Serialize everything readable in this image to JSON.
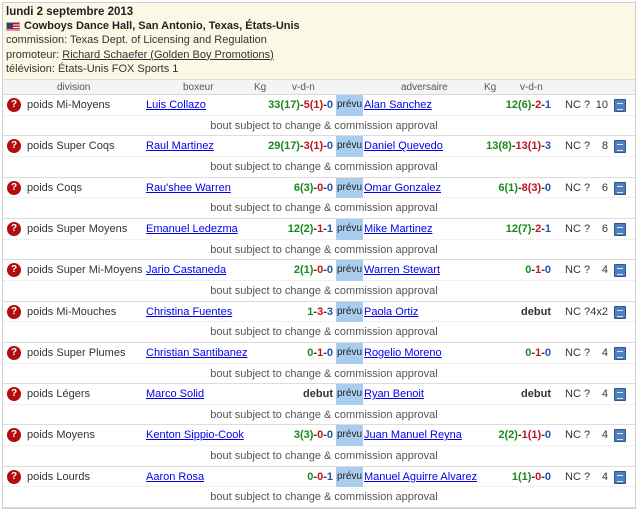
{
  "event": {
    "date": "lundi 2 septembre 2013",
    "venue": "Cowboys Dance Hall, San Antonio, Texas, États-Unis",
    "commission_label": "commission: Texas Dept. of Licensing and Regulation",
    "promoter_prefix": "promoteur: ",
    "promoter_name": "Richard Schaefer (Golden Boy Promotions)",
    "tv_label": "télévision: États-Unis FOX Sports 1"
  },
  "columns": {
    "division": "division",
    "boxer": "boxeur",
    "kg1": "Kg",
    "vdn1": "v-d-n",
    "opponent": "adversaire",
    "kg2": "Kg",
    "vdn2": "v-d-n"
  },
  "labels": {
    "status": "prévu",
    "note": "bout subject to change & commission approval",
    "q_icon": "?"
  },
  "colors": {
    "won": "#1a8a1a",
    "lost": "#c0141e",
    "draw": "#2850b8",
    "prevu_bg": "#a9cdee",
    "header_bg": "#fbf8e6"
  },
  "bouts": [
    {
      "division": "poids Mi-Moyens",
      "boxer": "Luis Collazo",
      "rec1": {
        "w": "33(17)",
        "d": "5(1)",
        "n": "0"
      },
      "opponent": "Alan Sanchez",
      "rec2": {
        "w": "12(6)",
        "d": "2",
        "n": "1"
      },
      "nc": "NC ?",
      "rounds": "10"
    },
    {
      "division": "poids Super Coqs",
      "boxer": "Raul Martinez",
      "rec1": {
        "w": "29(17)",
        "d": "3(1)",
        "n": "0"
      },
      "opponent": "Daniel Quevedo",
      "rec2": {
        "w": "13(8)",
        "d": "13(1)",
        "n": "3"
      },
      "nc": "NC ?",
      "rounds": "8"
    },
    {
      "division": "poids Coqs",
      "boxer": "Rau'shee Warren",
      "rec1": {
        "w": "6(3)",
        "d": "0",
        "n": "0"
      },
      "opponent": "Omar Gonzalez",
      "rec2": {
        "w": "6(1)",
        "d": "8(3)",
        "n": "0"
      },
      "nc": "NC ?",
      "rounds": "6"
    },
    {
      "division": "poids Super Moyens",
      "boxer": "Emanuel Ledezma",
      "rec1": {
        "w": "12(2)",
        "d": "1",
        "n": "1"
      },
      "opponent": "Mike Martinez",
      "rec2": {
        "w": "12(7)",
        "d": "2",
        "n": "1"
      },
      "nc": "NC ?",
      "rounds": "6"
    },
    {
      "division": "poids Super Mi-Moyens",
      "boxer": "Jario Castaneda",
      "rec1": {
        "w": "2(1)",
        "d": "0",
        "n": "0"
      },
      "opponent": "Warren Stewart",
      "rec2": {
        "w": "0",
        "d": "1",
        "n": "0"
      },
      "nc": "NC ?",
      "rounds": "4"
    },
    {
      "division": "poids Mi-Mouches",
      "boxer": "Christina Fuentes",
      "rec1": {
        "w": "1",
        "d": "3",
        "n": "3"
      },
      "opponent": "Paola Ortiz",
      "rec2_debut": "debut",
      "nc": "NC ?",
      "rounds": "4x2"
    },
    {
      "division": "poids Super Plumes",
      "boxer": "Christian Santibanez",
      "rec1": {
        "w": "0",
        "d": "1",
        "n": "0"
      },
      "opponent": "Rogelio Moreno",
      "rec2": {
        "w": "0",
        "d": "1",
        "n": "0"
      },
      "nc": "NC ?",
      "rounds": "4"
    },
    {
      "division": "poids Légers",
      "boxer": "Marco Solid",
      "rec1_debut": "debut",
      "opponent": "Ryan Benoit",
      "rec2_debut": "debut",
      "nc": "NC ?",
      "rounds": "4"
    },
    {
      "division": "poids Moyens",
      "boxer": "Kenton Sippio-Cook",
      "rec1": {
        "w": "3(3)",
        "d": "0",
        "n": "0"
      },
      "opponent": "Juan Manuel Reyna",
      "rec2": {
        "w": "2(2)",
        "d": "1(1)",
        "n": "0"
      },
      "nc": "NC ?",
      "rounds": "4"
    },
    {
      "division": "poids Lourds",
      "boxer": "Aaron Rosa",
      "rec1": {
        "w": "0",
        "d": "0",
        "n": "1"
      },
      "opponent": "Manuel Aguirre Alvarez",
      "rec2": {
        "w": "1(1)",
        "d": "0",
        "n": "0"
      },
      "nc": "NC ?",
      "rounds": "4"
    }
  ]
}
